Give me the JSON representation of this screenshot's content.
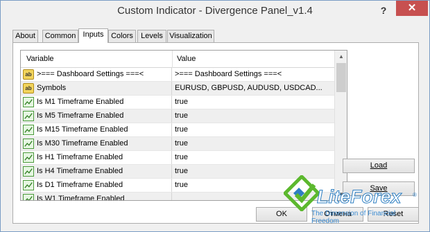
{
  "window": {
    "title": "Custom Indicator - Divergence Panel_v1.4",
    "help_label": "?",
    "close_label": "✕"
  },
  "tabs": [
    {
      "label": "About",
      "active": false
    },
    {
      "label": "Common",
      "active": false
    },
    {
      "label": "Inputs",
      "active": true
    },
    {
      "label": "Colors",
      "active": false
    },
    {
      "label": "Levels",
      "active": false
    },
    {
      "label": "Visualization",
      "active": false
    }
  ],
  "grid": {
    "columns": [
      "Variable",
      "Value"
    ],
    "rows": [
      {
        "icon": "ab-text-icon",
        "variable": ">=== Dashboard Settings ===<",
        "value": ">=== Dashboard Settings ===<"
      },
      {
        "icon": "ab-text-icon",
        "variable": "Symbols",
        "value": "EURUSD, GBPUSD, AUDUSD, USDCAD..."
      },
      {
        "icon": "chart-line-icon",
        "variable": "Is M1 Timeframe Enabled",
        "value": "true"
      },
      {
        "icon": "chart-line-icon",
        "variable": "Is M5 Timeframe Enabled",
        "value": "true"
      },
      {
        "icon": "chart-line-icon",
        "variable": "Is M15 Timeframe Enabled",
        "value": "true"
      },
      {
        "icon": "chart-line-icon",
        "variable": "Is M30 Timeframe Enabled",
        "value": "true"
      },
      {
        "icon": "chart-line-icon",
        "variable": "Is H1 Timeframe Enabled",
        "value": "true"
      },
      {
        "icon": "chart-line-icon",
        "variable": "Is H4 Timeframe Enabled",
        "value": "true"
      },
      {
        "icon": "chart-line-icon",
        "variable": "Is D1 Timeframe Enabled",
        "value": "true"
      },
      {
        "icon": "chart-line-icon",
        "variable": "Is W1 Timeframe Enabled",
        "value": ""
      }
    ]
  },
  "buttons": {
    "load": "Load",
    "save": "Save",
    "ok": "OK",
    "cancel": "Отмена",
    "reset": "Reset"
  },
  "watermark": {
    "brand": "LiteForex",
    "tagline": "The Dimension of Financial Freedom",
    "registered": "®"
  },
  "colors": {
    "close_button": "#c75050",
    "brand_blue": "#2e7fc2",
    "brand_green": "#5cb82e"
  }
}
